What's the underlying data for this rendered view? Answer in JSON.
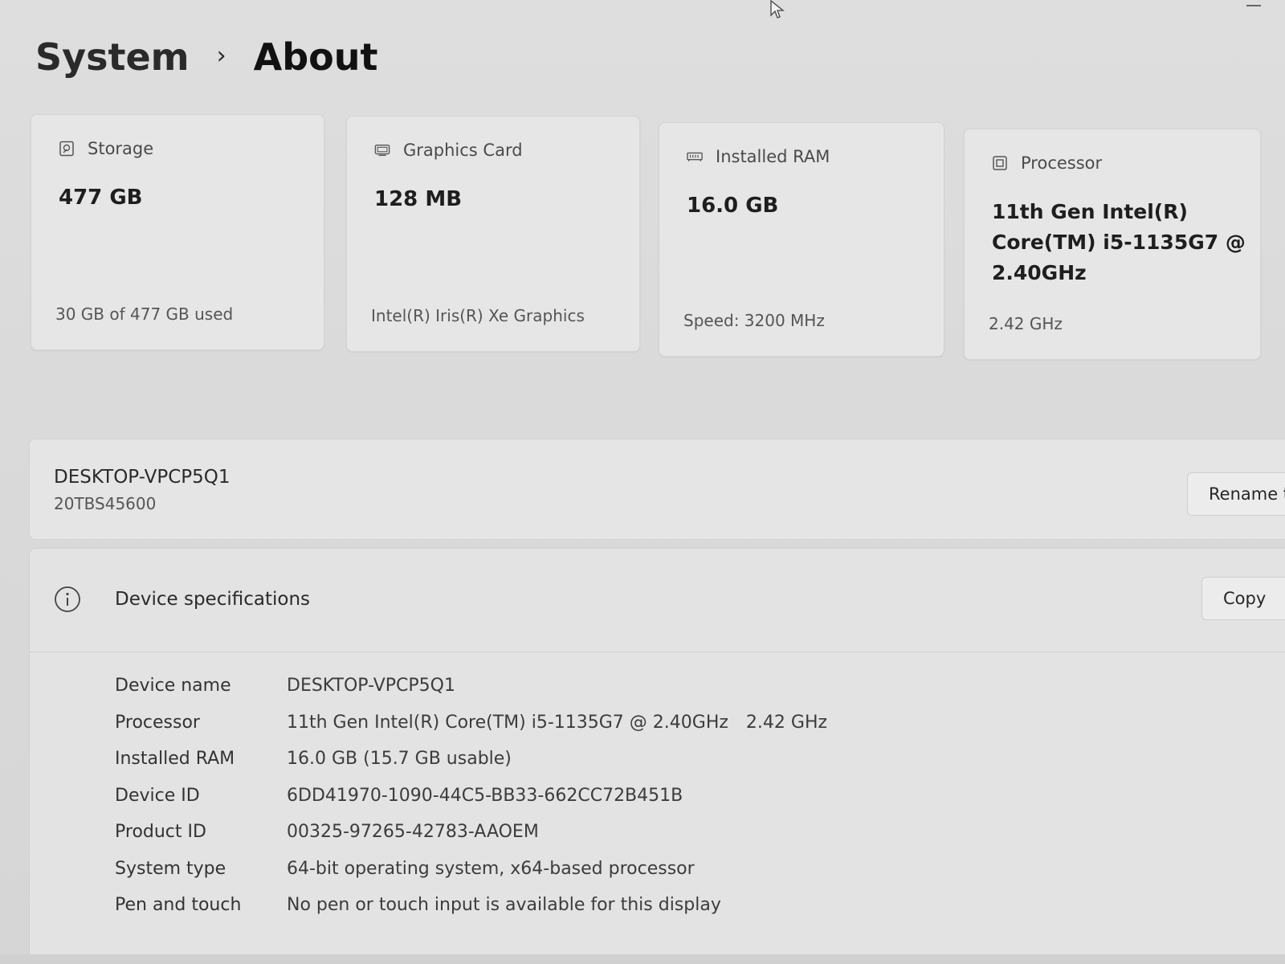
{
  "breadcrumb": {
    "parent": "System",
    "separator": "›",
    "current": "About"
  },
  "cards": [
    {
      "icon": "storage-icon",
      "label": "Storage",
      "value": "477 GB",
      "sub": "30 GB of 477 GB used"
    },
    {
      "icon": "graphics-card-icon",
      "label": "Graphics Card",
      "value": "128 MB",
      "sub": "Intel(R) Iris(R) Xe Graphics"
    },
    {
      "icon": "ram-icon",
      "label": "Installed RAM",
      "value": "16.0 GB",
      "sub": "Speed: 3200 MHz"
    },
    {
      "icon": "processor-icon",
      "label": "Processor",
      "value_lines": [
        "11th Gen Intel(R)",
        "Core(TM) i5-1135G7 @",
        "2.40GHz"
      ],
      "sub": "2.42 GHz"
    }
  ],
  "device": {
    "name": "DESKTOP-VPCP5Q1",
    "model": "20TBS45600",
    "rename_label": "Rename t"
  },
  "specs": {
    "title": "Device specifications",
    "copy_label": "Copy",
    "rows": [
      {
        "key": "Device name",
        "value": "DESKTOP-VPCP5Q1"
      },
      {
        "key": "Processor",
        "value": "11th Gen Intel(R) Core(TM) i5-1135G7 @ 2.40GHz",
        "value2": "2.42 GHz"
      },
      {
        "key": "Installed RAM",
        "value": "16.0 GB (15.7 GB usable)"
      },
      {
        "key": "Device ID",
        "value": "6DD41970-1090-44C5-BB33-662CC72B451B"
      },
      {
        "key": "Product ID",
        "value": "00325-97265-42783-AAOEM"
      },
      {
        "key": "System type",
        "value": "64-bit operating system, x64-based processor"
      },
      {
        "key": "Pen and touch",
        "value": "No pen or touch input is available for this display"
      }
    ]
  },
  "colors": {
    "background": "#dcdcdc",
    "card": "#e6e6e6",
    "text": "#1c1c1c"
  }
}
